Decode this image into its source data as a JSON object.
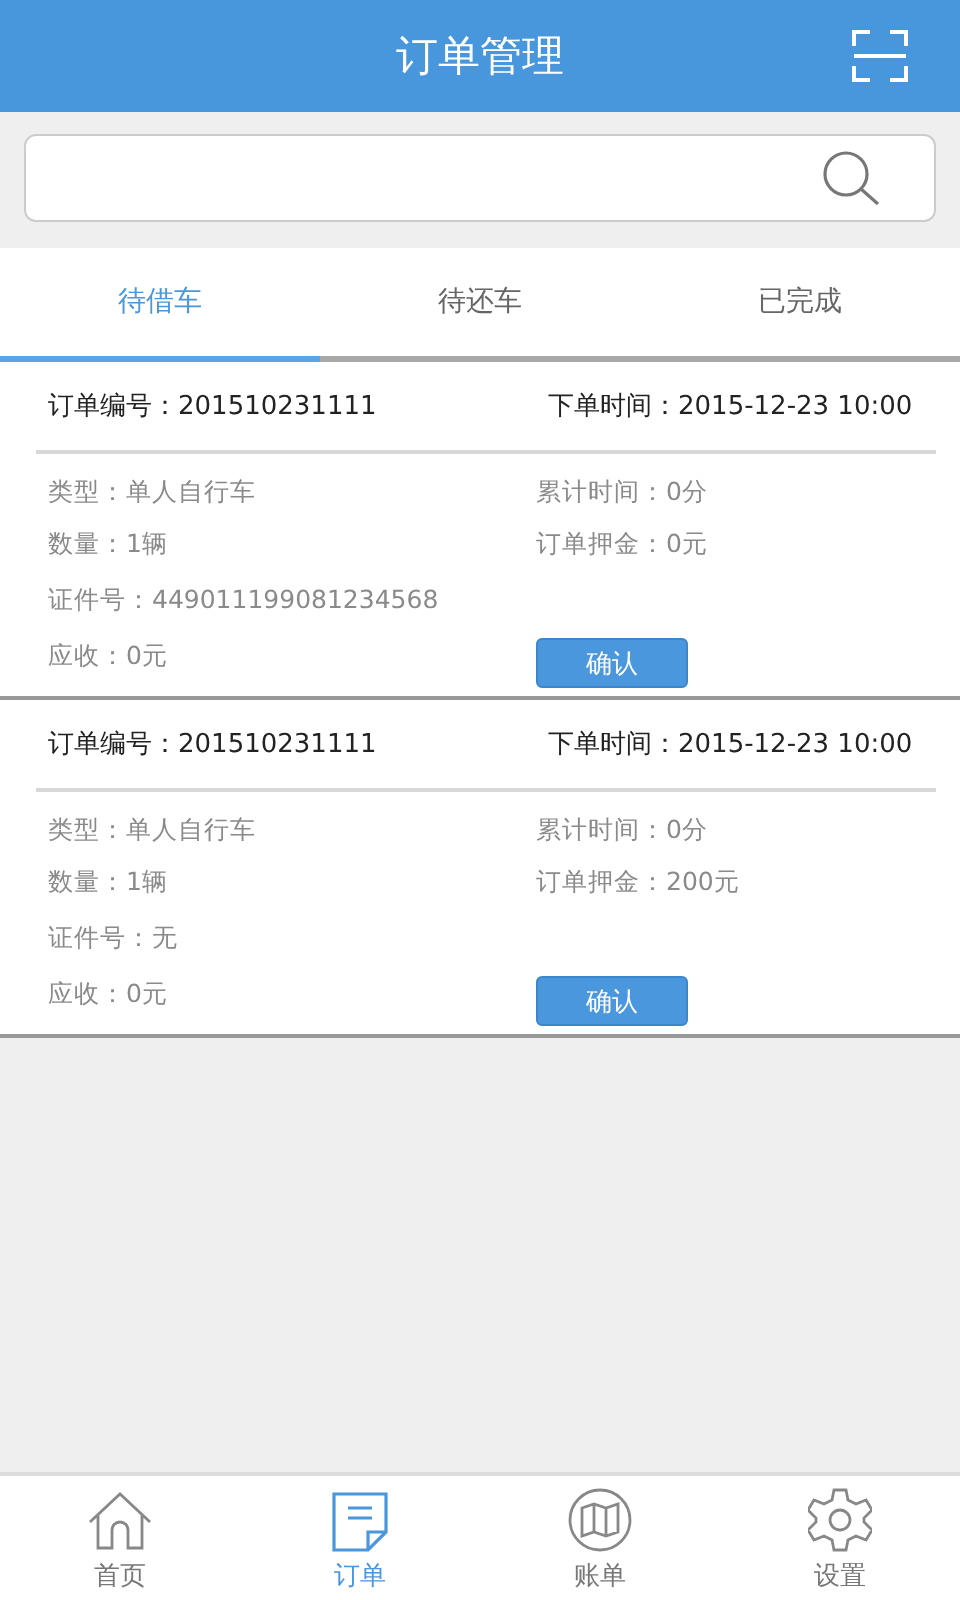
{
  "header": {
    "title": "订单管理"
  },
  "tabs": [
    {
      "label": "待借车",
      "selected": true
    },
    {
      "label": "待还车",
      "selected": false
    },
    {
      "label": "已完成",
      "selected": false
    }
  ],
  "orders": [
    {
      "order_no": "订单编号：201510231111",
      "order_time": "下单时间：2015-12-23 10:00",
      "left": [
        "类型：单人自行车",
        "数量：1辆",
        "证件号：449011199081234568",
        "应收：0元"
      ],
      "right": [
        "累计时间：0分",
        "订单押金：0元"
      ],
      "button": "确认"
    },
    {
      "order_no": "订单编号：201510231111",
      "order_time": "下单时间：2015-12-23 10:00",
      "left": [
        "类型：单人自行车",
        "数量：1辆",
        "证件号：无",
        "应收：0元"
      ],
      "right": [
        "累计时间：0分",
        "订单押金：200元"
      ],
      "button": "确认"
    }
  ],
  "nav": [
    {
      "kind": "home",
      "label": "首页",
      "selected": false
    },
    {
      "kind": "orders",
      "label": "订单",
      "selected": true
    },
    {
      "kind": "bills",
      "label": "账单",
      "selected": false
    },
    {
      "kind": "settings",
      "label": "设置",
      "selected": false
    }
  ]
}
